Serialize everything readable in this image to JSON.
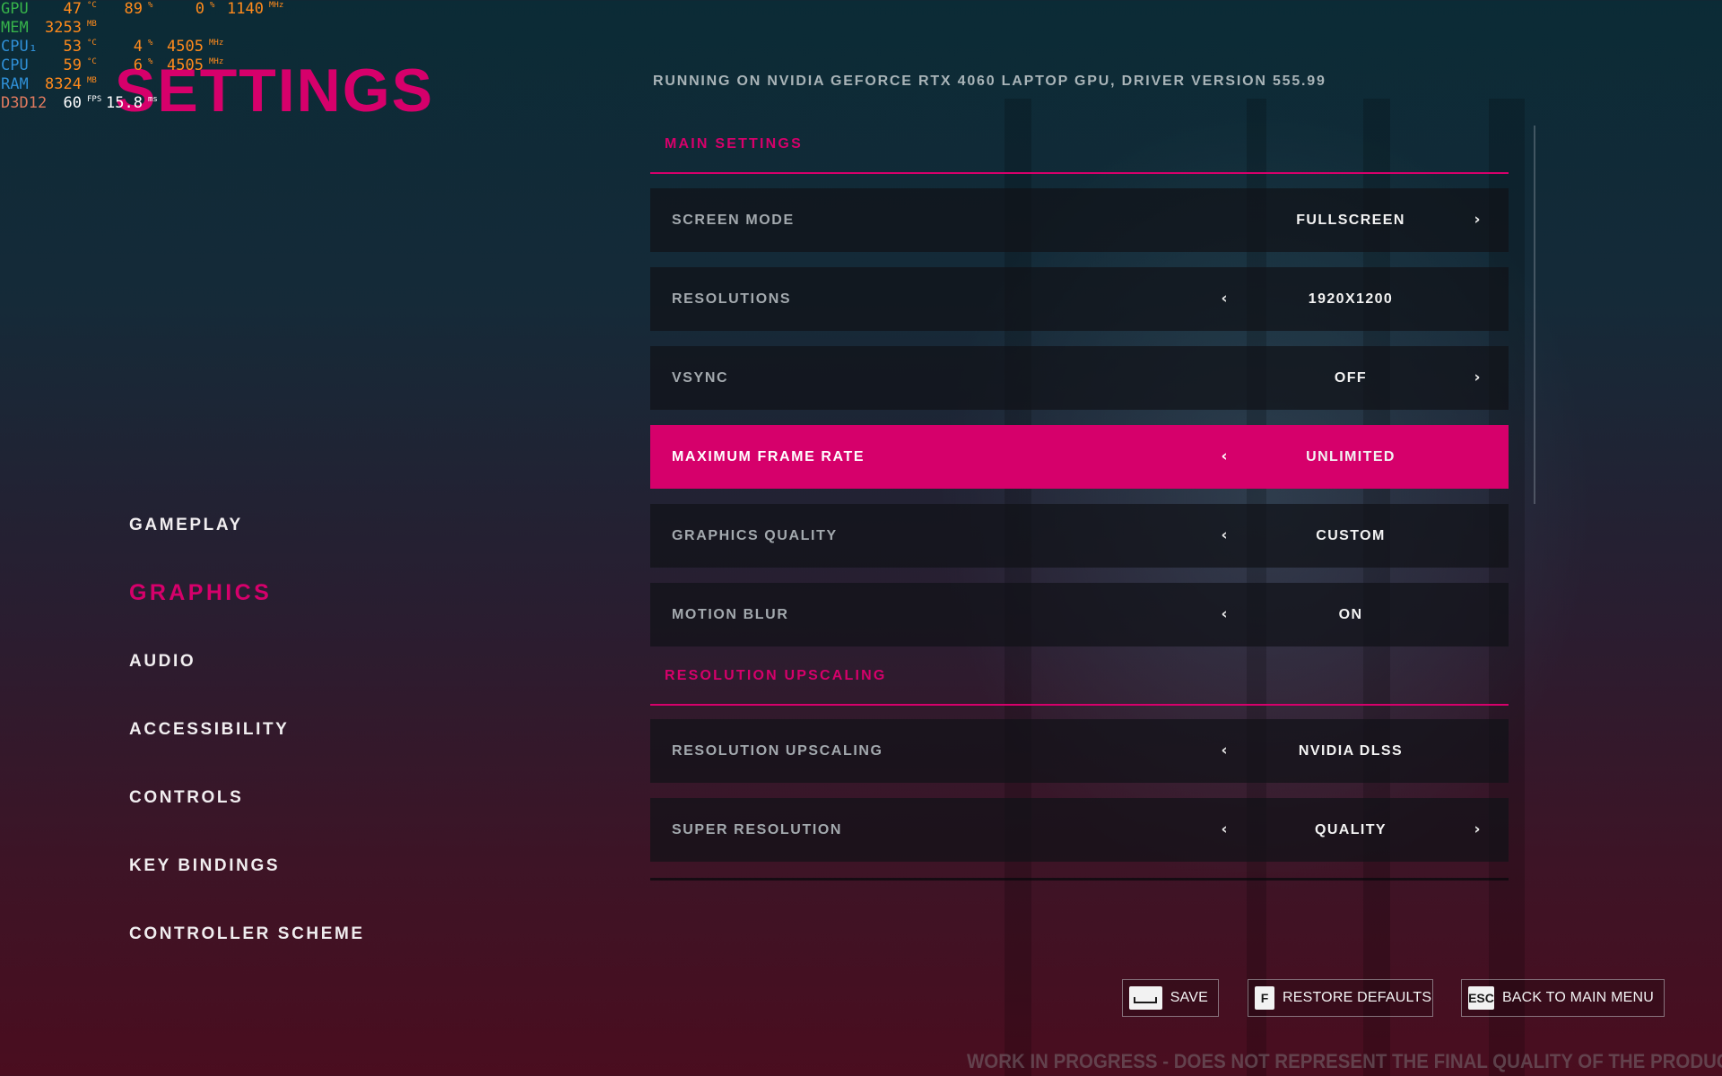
{
  "perf_overlay": {
    "rows": [
      {
        "label": "GPU",
        "label_color": "#37b34a",
        "cells": [
          {
            "value": "47",
            "unit": "°C"
          },
          {
            "value": "89",
            "unit": "%"
          },
          {
            "value": "0",
            "unit": "%"
          },
          {
            "value": "1140",
            "unit": "MHz"
          }
        ]
      },
      {
        "label": "MEM",
        "label_color": "#37b34a",
        "cells": [
          {
            "value": "3253",
            "unit": "MB"
          }
        ]
      },
      {
        "label": "CPU₁",
        "label_color": "#2f8fd6",
        "cells": [
          {
            "value": "53",
            "unit": "°C"
          },
          {
            "value": "4",
            "unit": "%"
          },
          {
            "value": "4505",
            "unit": "MHz"
          }
        ]
      },
      {
        "label": "CPU",
        "label_color": "#2f8fd6",
        "cells": [
          {
            "value": "59",
            "unit": "°C"
          },
          {
            "value": "6",
            "unit": "%"
          },
          {
            "value": "4505",
            "unit": "MHz"
          }
        ]
      },
      {
        "label": "RAM",
        "label_color": "#2f8fd6",
        "cells": [
          {
            "value": "8324",
            "unit": "MB"
          }
        ]
      },
      {
        "label": "D3D12",
        "label_color": "#e07a5f",
        "cells": [
          {
            "value": "60",
            "unit": "FPS"
          },
          {
            "value": "15.8",
            "unit": "ms"
          }
        ]
      }
    ],
    "value_color": "#ff8a1c",
    "fps_color": "#ffffff"
  },
  "title": "SETTINGS",
  "gpu_info": "RUNNING ON NVIDIA GEFORCE RTX 4060 LAPTOP GPU, DRIVER VERSION 555.99",
  "nav": {
    "items": [
      {
        "label": "GAMEPLAY",
        "active": false
      },
      {
        "label": "GRAPHICS",
        "active": true
      },
      {
        "label": "AUDIO",
        "active": false
      },
      {
        "label": "ACCESSIBILITY",
        "active": false
      },
      {
        "label": "CONTROLS",
        "active": false
      },
      {
        "label": "KEY BINDINGS",
        "active": false
      },
      {
        "label": "CONTROLLER SCHEME",
        "active": false
      }
    ]
  },
  "sections": [
    {
      "title": "MAIN SETTINGS",
      "rows": [
        {
          "label": "SCREEN MODE",
          "value": "FULLSCREEN",
          "left_arrow": false,
          "right_arrow": true,
          "active": false
        },
        {
          "label": "RESOLUTIONS",
          "value": "1920X1200",
          "left_arrow": true,
          "right_arrow": false,
          "active": false
        },
        {
          "label": "VSYNC",
          "value": "OFF",
          "left_arrow": false,
          "right_arrow": true,
          "active": false
        },
        {
          "label": "MAXIMUM FRAME RATE",
          "value": "UNLIMITED",
          "left_arrow": true,
          "right_arrow": false,
          "active": true
        },
        {
          "label": "GRAPHICS QUALITY",
          "value": "CUSTOM",
          "left_arrow": true,
          "right_arrow": false,
          "active": false
        },
        {
          "label": "MOTION BLUR",
          "value": "ON",
          "left_arrow": true,
          "right_arrow": false,
          "active": false
        }
      ]
    },
    {
      "title": "RESOLUTION UPSCALING",
      "rows": [
        {
          "label": "RESOLUTION UPSCALING",
          "value": "NVIDIA DLSS",
          "left_arrow": true,
          "right_arrow": false,
          "active": false
        },
        {
          "label": "SUPER RESOLUTION",
          "value": "QUALITY",
          "left_arrow": true,
          "right_arrow": true,
          "active": false
        }
      ]
    }
  ],
  "arrows": {
    "left": "‹",
    "right": "›"
  },
  "buttons": {
    "save": {
      "key": "",
      "key_icon": "spacebar-icon",
      "label": "SAVE"
    },
    "restore": {
      "key": "F",
      "label": "RESTORE DEFAULTS"
    },
    "back": {
      "key": "ESC",
      "label": "BACK TO MAIN MENU"
    }
  },
  "footer_notice": "WORK IN PROGRESS - DOES NOT REPRESENT THE FINAL QUALITY OF THE PRODUCT",
  "colors": {
    "accent": "#d6006b",
    "text": "#f1eef0",
    "muted": "#a3a9ae"
  }
}
